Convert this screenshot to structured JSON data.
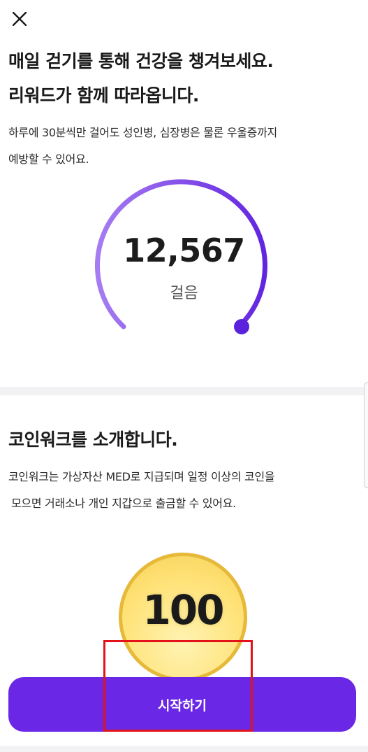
{
  "header": {
    "close_icon": "close-icon"
  },
  "intro": {
    "title_line1": "매일 걷기를 통해 건강을 챙겨보세요.",
    "title_line2": "리워드가 함께 따라옵니다.",
    "desc_line1": "하루에 30분씩만 걸어도 성인병, 심장병은 물론 우울증까지",
    "desc_line2": "예방할 수 있어요."
  },
  "steps": {
    "value": "12,567",
    "unit": "걸음",
    "gauge_colors": {
      "start": "#a67cf2",
      "end": "#6225e0",
      "knob": "#5b22de"
    }
  },
  "coinwalk": {
    "title": "코인워크를 소개합니다.",
    "desc_line1": "코인워크는 가상자산 MED로 지급되며 일정 이상의 코인을",
    "desc_line2": "모으면 거래소나 개인 지갑으로 출금할 수 있어요.",
    "coin_value": "100"
  },
  "cta": {
    "start_label": "시작하기",
    "color": "#6a28e6"
  },
  "annotation": {
    "highlight_color": "#e3121a"
  }
}
